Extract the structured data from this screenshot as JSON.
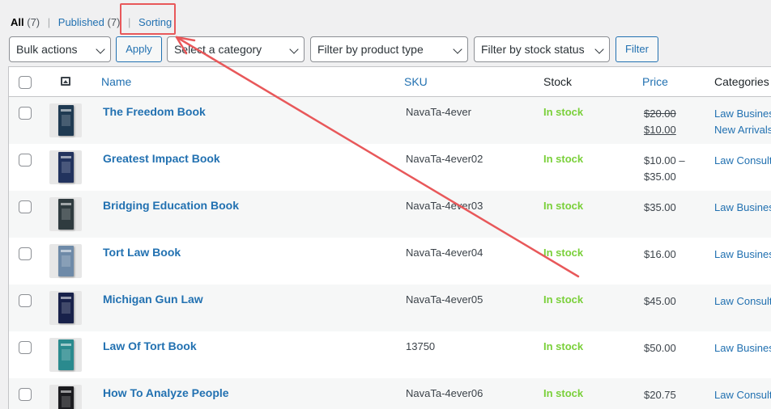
{
  "views": {
    "all_label": "All",
    "all_count": "(7)",
    "published_label": "Published",
    "published_count": "(7)",
    "sorting_label": "Sorting"
  },
  "filters": {
    "bulk_actions": "Bulk actions",
    "apply": "Apply",
    "category": "Select a category",
    "product_type": "Filter by product type",
    "stock_status": "Filter by stock status",
    "filter": "Filter"
  },
  "columns": {
    "name": "Name",
    "sku": "SKU",
    "stock": "Stock",
    "price": "Price",
    "categories": "Categories"
  },
  "rows": [
    {
      "name": "The Freedom Book",
      "sku": "NavaTa-4ever",
      "stock": "In stock",
      "price_old": "$20.00",
      "price_new": "$10.00",
      "cat1": "Law Business",
      "cat2": "New Arrivals",
      "cover": "#1f3a52"
    },
    {
      "name": "Greatest Impact Book",
      "sku": "NavaTa-4ever02",
      "stock": "In stock",
      "price_line1": "$10.00 –",
      "price_line2": "$35.00",
      "cat1": "Law Consulting",
      "cover": "#22335e"
    },
    {
      "name": "Bridging Education Book",
      "sku": "NavaTa-4ever03",
      "stock": "In stock",
      "price_line1": "$35.00",
      "cat1": "Law Business",
      "cover": "#2f3b3f"
    },
    {
      "name": "Tort Law Book",
      "sku": "NavaTa-4ever04",
      "stock": "In stock",
      "price_line1": "$16.00",
      "cat1": "Law Business",
      "cover": "#6e8aa8"
    },
    {
      "name": "Michigan Gun Law",
      "sku": "NavaTa-4ever05",
      "stock": "In stock",
      "price_line1": "$45.00",
      "cat1": "Law Consulting",
      "cover": "#18214a"
    },
    {
      "name": "Law Of Tort Book",
      "sku": "13750",
      "stock": "In stock",
      "price_line1": "$50.00",
      "cat1": "Law Business",
      "cover": "#2a8a8e"
    },
    {
      "name": "How To Analyze People",
      "sku": "NavaTa-4ever06",
      "stock": "In stock",
      "price_line1": "$20.75",
      "cat1": "Law Consulting",
      "cover": "#1b1b1f"
    }
  ],
  "annotation_color": "#e8585a"
}
